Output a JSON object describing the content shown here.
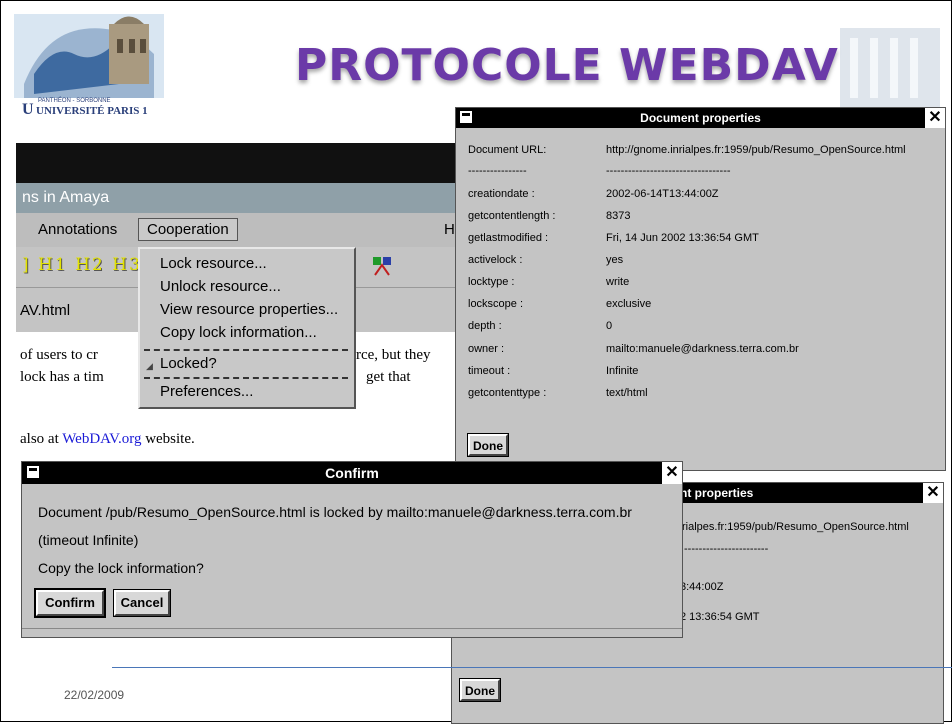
{
  "slide": {
    "title": "PROTOCOLE WEBDAV",
    "date": "22/02/2009",
    "logo_text": "UNIVERSITÉ PARIS 1",
    "logo_subtext": "PANTHÉON - SORBONNE"
  },
  "amaya": {
    "window_title": "ns in Amaya",
    "menu": {
      "annotations": "Annotations",
      "cooperation": "Cooperation",
      "help_partial": "H"
    },
    "toolbar_text": "] H1 H2 H3",
    "url_text": "AV.html",
    "doc": {
      "line1": "of users to cr",
      "line1_tail": "rce, but they",
      "line2": "lock has a tim",
      "line2_tail": "get that",
      "line3_prefix": "also at ",
      "line3_link": "WebDAV.org",
      "line3_suffix": " website."
    },
    "dropdown": {
      "items": [
        "Lock resource...",
        "Unlock resource...",
        "View resource properties...",
        "Copy lock information...",
        "Locked?",
        "Preferences..."
      ]
    }
  },
  "doc_props_top": {
    "title": "Document properties",
    "close": "✕",
    "rows": [
      {
        "key": "Document URL:",
        "value": "http://gnome.inrialpes.fr:1959/pub/Resumo_OpenSource.html"
      },
      {
        "key": "----------------",
        "value": "----------------------------------"
      },
      {
        "key": "creationdate :",
        "value": "2002-06-14T13:44:00Z"
      },
      {
        "key": "getcontentlength :",
        "value": "8373"
      },
      {
        "key": "getlastmodified :",
        "value": "Fri, 14 Jun 2002 13:36:54 GMT"
      },
      {
        "key": "activelock :",
        "value": "yes"
      },
      {
        "key": "locktype :",
        "value": "write"
      },
      {
        "key": "lockscope :",
        "value": "exclusive"
      },
      {
        "key": "depth :",
        "value": "0"
      },
      {
        "key": "owner :",
        "value": "mailto:manuele@darkness.terra.com.br"
      },
      {
        "key": "timeout :",
        "value": "Infinite"
      },
      {
        "key": "getcontenttype :",
        "value": "text/html"
      }
    ],
    "done_label": "Done"
  },
  "doc_props_bottom": {
    "title_partial": "nt properties",
    "close": "✕",
    "rows": [
      {
        "value": "rialpes.fr:1959/pub/Resumo_OpenSource.html"
      },
      {
        "value": "-----------------------"
      },
      {
        "value": "3:44:00Z"
      },
      {
        "value": "2 13:36:54 GMT"
      }
    ],
    "done_label": "Done"
  },
  "confirm": {
    "title": "Confirm",
    "close": "✕",
    "message_line1": "Document /pub/Resumo_OpenSource.html is locked by mailto:manuele@darkness.terra.com.br",
    "message_line2": "(timeout Infinite)",
    "question": "Copy the lock information?",
    "confirm_label": "Confirm",
    "cancel_label": "Cancel"
  },
  "colors": {
    "title_purple": "#6b3aa8",
    "window_gray": "#c4c4c4",
    "titlebar_black": "#000000",
    "link_blue": "#1a1ad6",
    "footer_line": "#4a76b8"
  }
}
